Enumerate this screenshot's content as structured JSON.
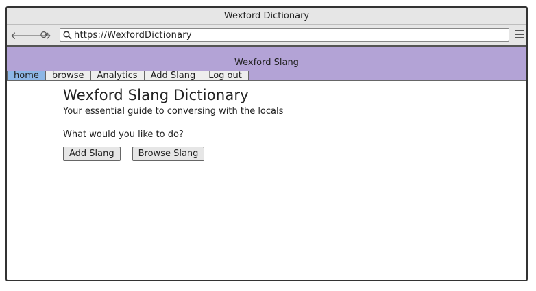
{
  "window": {
    "title": "Wexford Dictionary"
  },
  "toolbar": {
    "back_icon": "arrow-left",
    "forward_icon": "arrow-right",
    "reload_icon": "reload",
    "search_icon": "magnifier",
    "url": "https://WexfordDictionary",
    "menu_icon": "hamburger"
  },
  "header": {
    "title": "Wexford Slang",
    "background": "#b3a3d6",
    "tabs": [
      {
        "label": "home",
        "active": true
      },
      {
        "label": "browse",
        "active": false
      },
      {
        "label": "Analytics",
        "active": false
      },
      {
        "label": "Add Slang",
        "active": false
      },
      {
        "label": "Log out",
        "active": false
      }
    ],
    "active_tab_color": "#8db6e6"
  },
  "main": {
    "title": "Wexford Slang Dictionary",
    "subtitle": "Your essential guide to conversing with the locals",
    "prompt": "What would you like to do?",
    "buttons": {
      "add_label": "Add Slang",
      "browse_label": "Browse Slang"
    }
  }
}
